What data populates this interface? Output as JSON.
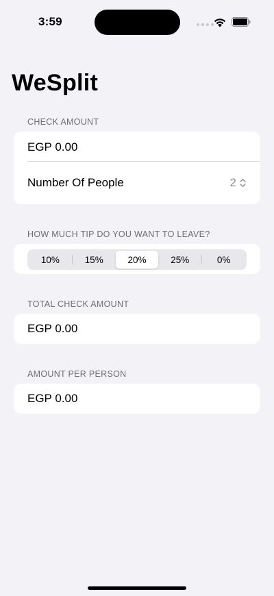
{
  "status_bar": {
    "time": "3:59"
  },
  "app": {
    "title": "WeSplit"
  },
  "check_section": {
    "header": "CHECK AMOUNT",
    "amount_value": "EGP 0.00",
    "people_label": "Number Of People",
    "people_value": "2"
  },
  "tip_section": {
    "header": "HOW MUCH TIP DO YOU WANT TO LEAVE?",
    "options": [
      "10%",
      "15%",
      "20%",
      "25%",
      "0%"
    ],
    "selected": "20%"
  },
  "total_section": {
    "header": "TOTAL CHECK AMOUNT",
    "value": "EGP 0.00"
  },
  "per_person_section": {
    "header": "AMOUNT PER PERSON",
    "value": "EGP 0.00"
  },
  "colors": {
    "background": "#f2f2f7",
    "card": "#ffffff",
    "secondary_text": "#6d6d72"
  }
}
